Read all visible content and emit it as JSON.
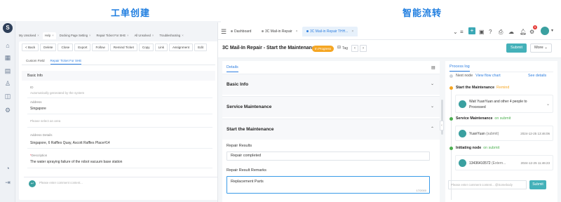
{
  "headings": {
    "left": "工单创建",
    "right": "智能流转"
  },
  "left": {
    "logo": "S",
    "tabs": [
      "My Unsolved",
      "Help",
      "Docking Page Setting",
      "Repair Ticket For SHE",
      "All Unsolved",
      "Troubleshooting"
    ],
    "toolbar": [
      "< Back",
      "Delete",
      "Close",
      "Export",
      "Follow",
      "Remind Ticket",
      "Copy",
      "Link",
      "Assignment",
      "Edit"
    ],
    "subtabs": [
      "Custom Field",
      "Repair Ticket For SHE"
    ],
    "section_title": "Basic Info",
    "id_label": "ID",
    "id_placeholder": "Automatically generated by the system",
    "address_label": "Address",
    "address_value": "Singapore",
    "area_placeholder": "Please select an area",
    "address_details_label": "Address Details",
    "address_details_value": "Singapore, 6 Raffles Quay, Ascott Raffles Place#14",
    "description_label": "Description",
    "description_value": "The water spraying failure of the robot vacuum base station",
    "comment_placeholder": "Please enter comment content..."
  },
  "right": {
    "tabs": [
      "Dashboard",
      "3C Mail-in Repair",
      "3C Mail-in Repair THH..."
    ],
    "title": "3C Mail-In Repair - Start the Maintenance",
    "status": "In Progress",
    "tag_label": "Tag",
    "submit": "Submit",
    "more": "More",
    "badge": "5",
    "details_tab": "Details",
    "sections": [
      "Basic Info",
      "Service Maintenance",
      "Start the Maintenance"
    ],
    "repair_results_label": "Repair Results",
    "repair_results_value": "Repair completed",
    "remarks_label": "Repair Result Remarks",
    "remarks_value": "Replacement Parts",
    "char_count": "17/2000",
    "process_log": {
      "title": "Process log",
      "next_node": "Next node",
      "view_flow_chart": "View flow chart",
      "see_details": "See details",
      "nodes": [
        {
          "name": "Start the Maintenance",
          "status": "Remind",
          "card": "Wait YuanYuan and other 4 people to",
          "card2": "Processed",
          "time": ""
        },
        {
          "name": "Service Maintenance",
          "status": "on submit",
          "card": "YuanYuan",
          "card_action": "(submit)",
          "time": "2024-12-25 13:46:06"
        },
        {
          "name": "Initiating node",
          "status": "on submit",
          "card": "13436410572",
          "card_action": "(Extern...",
          "time": "2024-12-25 11:46:23"
        }
      ],
      "comment_placeholder": "Please enter comment content... @Somebody",
      "comment_submit": "Submit"
    }
  },
  "colors": {
    "accent": "#2f7fe0",
    "teal": "#44b1b9",
    "orange": "#f5a623",
    "green": "#4caf50",
    "red": "#e53935"
  }
}
